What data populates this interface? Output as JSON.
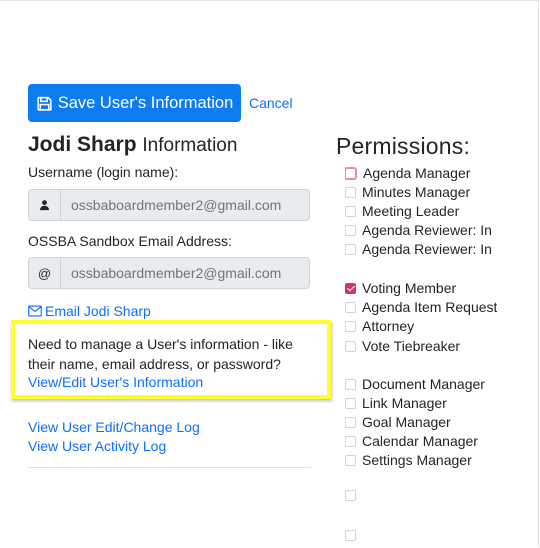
{
  "toolbar": {
    "save_label": "Save User's Information",
    "cancel_label": "Cancel"
  },
  "user": {
    "name": "Jodi Sharp",
    "heading_suffix": "Information"
  },
  "username": {
    "label": "Username (login name):",
    "prefix_icon": "person-icon",
    "value": "ossbaboardmember2@gmail.com"
  },
  "sandbox_email": {
    "label": "OSSBA Sandbox Email Address:",
    "prefix": "@",
    "value": "ossbaboardmember2@gmail.com"
  },
  "email_link": {
    "icon": "envelope-icon",
    "label": "Email Jodi Sharp"
  },
  "notice": {
    "text": "Need to manage a User's information - like their name, email address, or password?",
    "link": "View/Edit User's Information",
    "highlight_color": "#fefe33"
  },
  "links": {
    "change_log": "View User Edit/Change Log",
    "activity_log": "View User Activity Log"
  },
  "permissions": {
    "title": "Permissions:",
    "items": [
      {
        "label": "Agenda Manager",
        "checked": false
      },
      {
        "label": "Minutes Manager",
        "checked": false
      },
      {
        "label": "Meeting Leader",
        "checked": false
      },
      {
        "label": "Agenda Reviewer: In Development",
        "checked": false
      },
      {
        "label": "Agenda Reviewer: In Review",
        "checked": false
      },
      {
        "label": "Voting Member",
        "checked": true
      },
      {
        "label": "Agenda Item Requestor",
        "checked": false
      },
      {
        "label": "Attorney",
        "checked": false
      },
      {
        "label": "Vote Tiebreaker",
        "checked": false
      },
      {
        "label": "Document Manager",
        "checked": false
      },
      {
        "label": "Link Manager",
        "checked": false
      },
      {
        "label": "Goal Manager",
        "checked": false
      },
      {
        "label": "Calendar Manager",
        "checked": false
      },
      {
        "label": "Settings Manager",
        "checked": false
      },
      {
        "label": "",
        "checked": false
      },
      {
        "label": "",
        "checked": false
      }
    ]
  },
  "colors": {
    "primary": "#0d7cf0",
    "link": "#0d6efd",
    "checkbox_checked": "#d6336c"
  }
}
